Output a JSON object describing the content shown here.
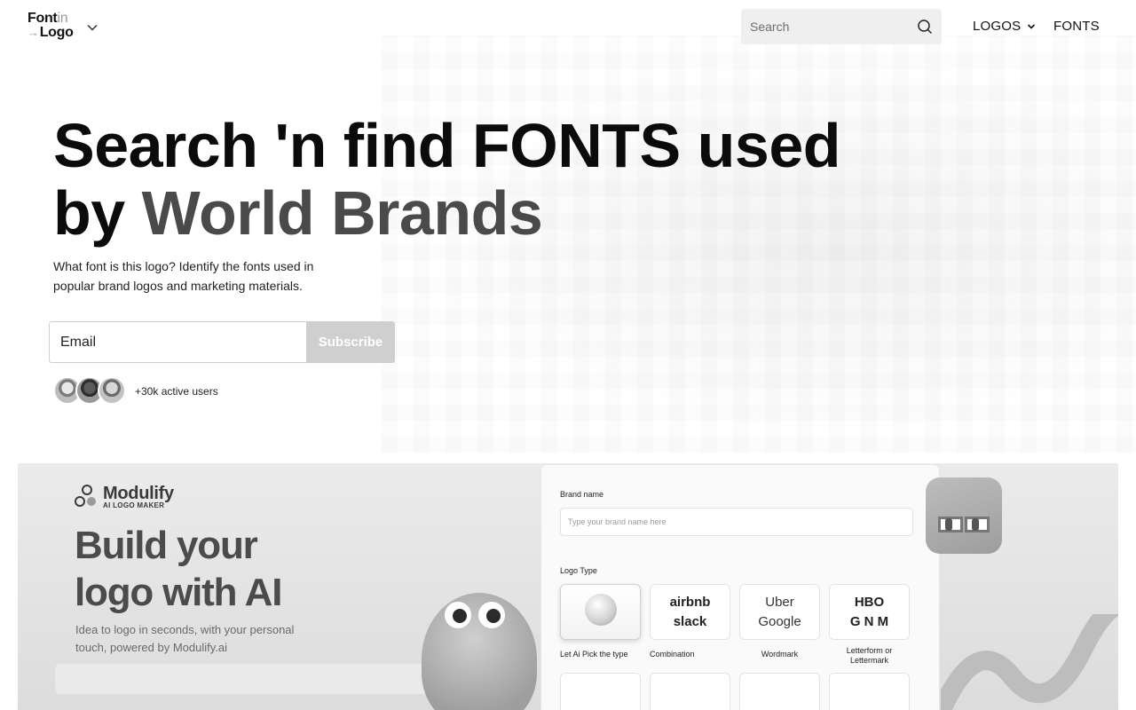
{
  "header": {
    "logo": {
      "line1": "Font",
      "line1_suffix": "in",
      "line2_prefix": "→",
      "line2": "Logo"
    },
    "search": {
      "placeholder": "Search"
    },
    "nav": {
      "logos": "LOGOS",
      "fonts": "FONTS"
    }
  },
  "hero": {
    "title_line1": "Search 'n find FONTS used",
    "title_line2_prefix": "by ",
    "title_line2_accent": "World Brands",
    "subtitle": "What font is this logo? Identify the fonts used in popular brand logos and marketing materials.",
    "email_placeholder": "Email",
    "subscribe_label": "Subscribe",
    "users_text": "+30k active users"
  },
  "banner": {
    "brand": "Modulify",
    "brand_tag": "AI LOGO MAKER",
    "title": "Build your logo with AI",
    "subtitle": "Idea to logo in seconds, with your personal touch, powered by Modulify.ai",
    "panel": {
      "brand_name_label": "Brand name",
      "brand_name_placeholder": "Type your brand name here",
      "logo_type_label": "Logo Type",
      "cards": [
        {
          "caption": "Let Ai Pick the type"
        },
        {
          "caption": "Combination",
          "row1": "airbnb",
          "row2": "slack"
        },
        {
          "caption": "Wordmark",
          "row1": "Uber",
          "row2": "Google"
        },
        {
          "caption": "Letterform or Lettermark",
          "row1": "HBO",
          "row2": "G N M"
        }
      ]
    }
  },
  "colors": {
    "text": "#111111",
    "accent_gray": "#4a4a4a",
    "subscribe_bg": "#cfcfcf",
    "search_bg": "#efefef"
  }
}
